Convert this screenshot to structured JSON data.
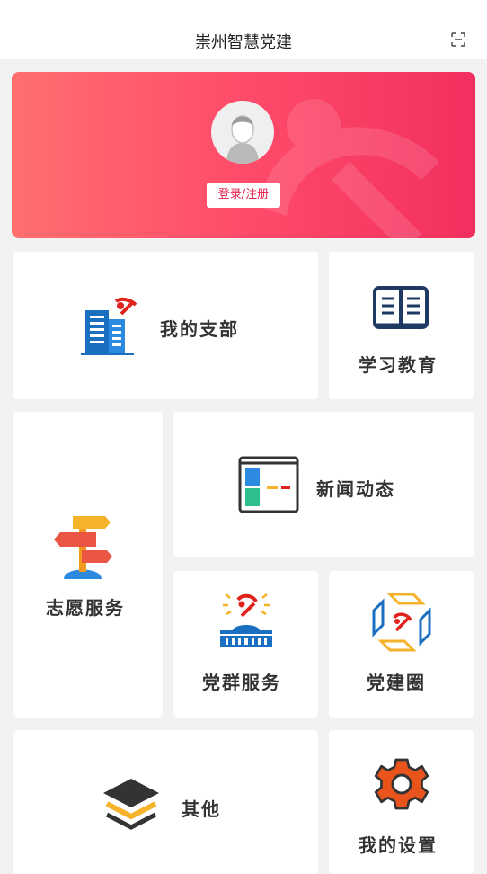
{
  "header": {
    "title": "崇州智慧党建",
    "scan_icon": "scan-icon"
  },
  "banner": {
    "login_label": "登录/注册",
    "avatar_icon": "user-avatar-icon"
  },
  "tiles": {
    "my_branch": {
      "label": "我的支部",
      "icon": "building-flag-icon"
    },
    "study": {
      "label": "学习教育",
      "icon": "open-book-icon"
    },
    "volunteer": {
      "label": "志愿服务",
      "icon": "signpost-icon"
    },
    "news": {
      "label": "新闻动态",
      "icon": "news-window-icon"
    },
    "mass_service": {
      "label": "党群服务",
      "icon": "hall-emblem-icon"
    },
    "circle": {
      "label": "党建圈",
      "icon": "circle-emblem-icon"
    },
    "other": {
      "label": "其他",
      "icon": "layers-icon"
    },
    "settings": {
      "label": "我的设置",
      "icon": "gear-icon"
    }
  },
  "colors": {
    "brand_red": "#e61e4a",
    "banner_start": "#ff6f6f",
    "banner_end": "#f22f5f"
  }
}
